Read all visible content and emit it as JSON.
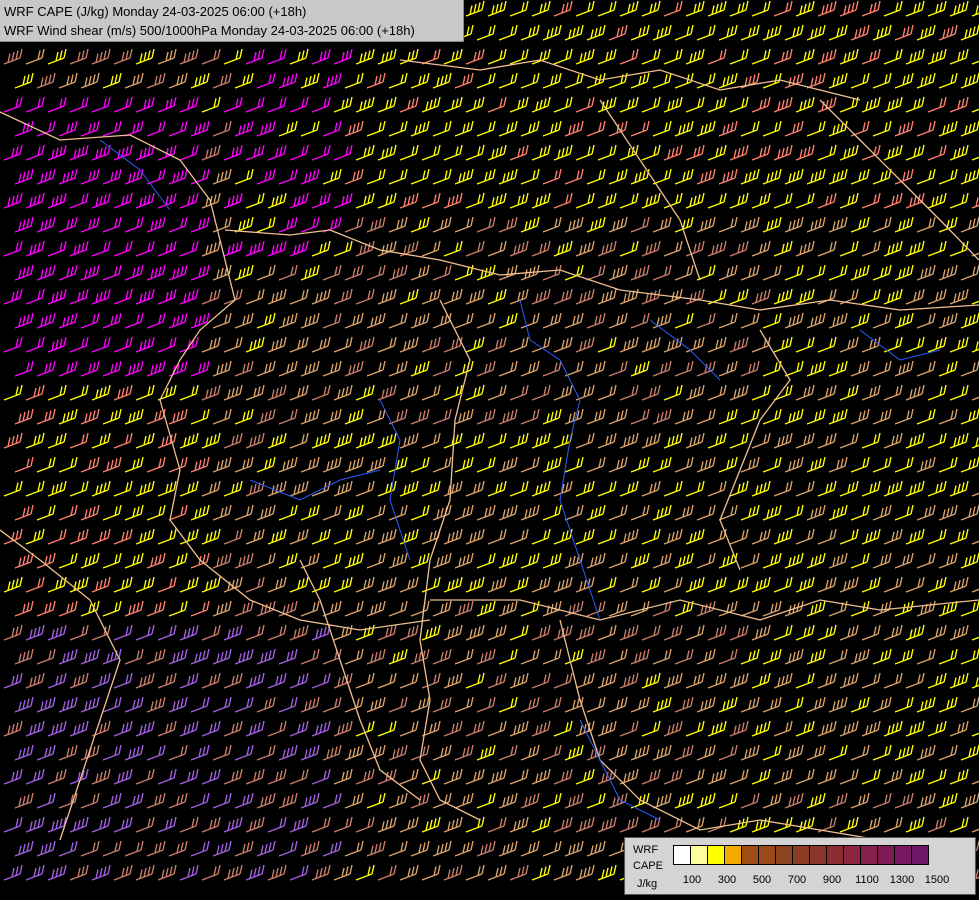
{
  "titles": {
    "line1": "WRF CAPE (J/kg) Monday 24-03-2025 06:00 (+18h)",
    "line2": "WRF Wind shear (m/s) 500/1000hPa Monday 24-03-2025 06:00 (+18h)"
  },
  "legend": {
    "label_top": "WRF",
    "label_mid": "CAPE",
    "unit": "J/kg",
    "colors": [
      "#ffffff",
      "#fdfd9c",
      "#ffff00",
      "#f5a800",
      "#a04d13",
      "#9a4a1a",
      "#8f4420",
      "#8a3d25",
      "#8a3529",
      "#8b2d33",
      "#8a2640",
      "#851f4b",
      "#7d1b55",
      "#761860",
      "#6e1567"
    ],
    "tick_labels": [
      "100",
      "300",
      "500",
      "700",
      "900",
      "1100",
      "1300",
      "1500"
    ]
  },
  "map": {
    "barb_colors": {
      "tan": "#d8a26a",
      "pink_brown": "#c77d6a",
      "yellow": "#ffff00",
      "magenta": "#ff00ff",
      "salmon": "#ff7f6e",
      "purple": "#a060e0"
    },
    "border_color": "#f0c090",
    "river_color": "#2a5cff",
    "background": "#000000"
  }
}
